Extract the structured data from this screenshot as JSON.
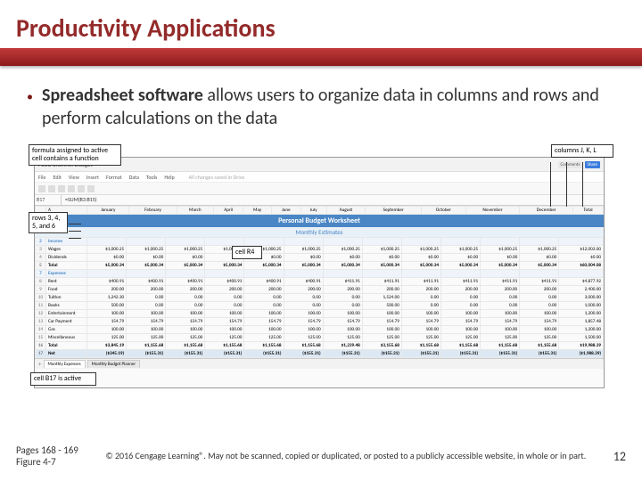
{
  "slide": {
    "title": "Productivity Applications",
    "bullet": {
      "term": "Spreadsheet software",
      "rest": " allows users to organize data in columns and rows and perform calculations on the data"
    }
  },
  "callouts": {
    "formula": "formula assigned to active cell contains a function",
    "rows": "rows 3, 4, 5, and 6",
    "cellR4": "cell R4",
    "cols": "columns J, K, L",
    "active": "cell B17 is active"
  },
  "spreadsheet": {
    "doc_title": "Food Channel Budget",
    "saved_text": "All changes saved in Drive",
    "buttons": {
      "comments": "Comments",
      "share": "Share"
    },
    "menus": [
      "File",
      "Edit",
      "View",
      "Insert",
      "Format",
      "Data",
      "Tools",
      "Help"
    ],
    "formula": {
      "ref": "B17",
      "text": "=SUM(B3:B15)"
    },
    "worksheet_title": "Personal Budget Worksheet",
    "worksheet_subtitle": "Monthly Estimates",
    "cols": [
      "",
      "A",
      "January",
      "February",
      "March",
      "April",
      "May",
      "June",
      "July",
      "August",
      "September",
      "October",
      "November",
      "December",
      "Total"
    ],
    "rows": [
      {
        "n": "2",
        "section": "Income"
      },
      {
        "n": "3",
        "label": "Wages",
        "v": [
          "$1,000.25",
          "$1,000.25",
          "$1,000.25",
          "$1,000.25",
          "$1,000.25",
          "$1,000.25",
          "$1,000.25",
          "$1,000.25",
          "$1,000.25",
          "$1,000.25",
          "$1,000.25",
          "$1,000.25",
          "$12,003.00"
        ]
      },
      {
        "n": "4",
        "label": "Dividends",
        "v": [
          "$0.00",
          "$0.00",
          "$0.00",
          "$0.00",
          "$0.00",
          "$0.00",
          "$0.00",
          "$0.00",
          "$0.00",
          "$0.00",
          "$0.00",
          "$0.00",
          "$0.00"
        ]
      },
      {
        "n": "5",
        "label": "Total",
        "total": true,
        "v": [
          "$5,000.34",
          "$5,000.34",
          "$5,000.34",
          "$5,000.34",
          "$5,000.34",
          "$5,000.34",
          "$5,000.34",
          "$5,000.34",
          "$5,000.34",
          "$5,000.34",
          "$5,000.34",
          "$5,000.34",
          "$60,004.08"
        ]
      },
      {
        "n": "7",
        "section": "Expenses"
      },
      {
        "n": "8",
        "label": "Rent",
        "v": [
          "$400.91",
          "$400.91",
          "$400.91",
          "$400.91",
          "$400.91",
          "$400.91",
          "$411.91",
          "$411.91",
          "$411.91",
          "$411.91",
          "$411.91",
          "$411.91",
          "$4,877.92"
        ]
      },
      {
        "n": "9",
        "label": "Food",
        "v": [
          "200.00",
          "200.00",
          "200.00",
          "200.00",
          "200.00",
          "200.00",
          "200.00",
          "200.00",
          "200.00",
          "200.00",
          "200.00",
          "200.00",
          "2,400.00"
        ]
      },
      {
        "n": "10",
        "label": "Tuition",
        "v": [
          "1,242.30",
          "0.00",
          "0.00",
          "0.00",
          "0.00",
          "0.00",
          "0.00",
          "1,524.00",
          "0.00",
          "0.00",
          "0.00",
          "0.00",
          "3,000.00"
        ]
      },
      {
        "n": "11",
        "label": "Books",
        "v": [
          "500.00",
          "0.00",
          "0.00",
          "0.00",
          "0.00",
          "0.00",
          "0.00",
          "500.00",
          "0.00",
          "0.00",
          "0.00",
          "0.00",
          "1,000.00"
        ]
      },
      {
        "n": "12",
        "label": "Entertainment",
        "v": [
          "100.00",
          "100.00",
          "100.00",
          "100.00",
          "100.00",
          "100.00",
          "100.00",
          "100.00",
          "100.00",
          "100.00",
          "100.00",
          "100.00",
          "1,200.00"
        ]
      },
      {
        "n": "13",
        "label": "Car Payment",
        "v": [
          "154.79",
          "154.79",
          "154.79",
          "154.79",
          "154.79",
          "154.79",
          "154.79",
          "154.79",
          "154.79",
          "154.79",
          "154.79",
          "154.79",
          "1,857.48"
        ]
      },
      {
        "n": "14",
        "label": "Gas",
        "v": [
          "100.00",
          "100.00",
          "100.00",
          "100.00",
          "100.00",
          "100.00",
          "100.00",
          "100.00",
          "100.00",
          "100.00",
          "100.00",
          "100.00",
          "1,200.00"
        ]
      },
      {
        "n": "15",
        "label": "Miscellaneous",
        "v": [
          "125.00",
          "125.00",
          "125.00",
          "125.00",
          "125.00",
          "125.00",
          "125.00",
          "125.00",
          "125.00",
          "125.00",
          "125.00",
          "125.00",
          "1,500.00"
        ]
      },
      {
        "n": "16",
        "label": "Total",
        "total": true,
        "v": [
          "$3,845.19",
          "$1,155.68",
          "$1,155.68",
          "$1,155.68",
          "$1,155.68",
          "$1,155.68",
          "$1,239.48",
          "$3,155.68",
          "$1,155.68",
          "$1,155.68",
          "$1,155.68",
          "$1,155.68",
          "$19,988.39"
        ]
      },
      {
        "n": "17",
        "label": "Net",
        "net": true,
        "v": [
          "($345.19)",
          "($155.31)",
          "($155.31)",
          "($155.31)",
          "($155.31)",
          "($155.31)",
          "($155.31)",
          "($155.31)",
          "($155.31)",
          "($155.31)",
          "($155.31)",
          "($155.31)",
          "($1,988.39)"
        ]
      }
    ],
    "tabs": [
      "Monthly Expenses",
      "Monthly Budget Planner"
    ]
  },
  "footer": {
    "pages": "Pages 168 - 169",
    "figure": "Figure 4-7",
    "copyright": "© 2016 Cengage Learning®. May not be scanned, copied or duplicated, or posted to a publicly accessible website, in whole or in part.",
    "page_num": "12"
  }
}
